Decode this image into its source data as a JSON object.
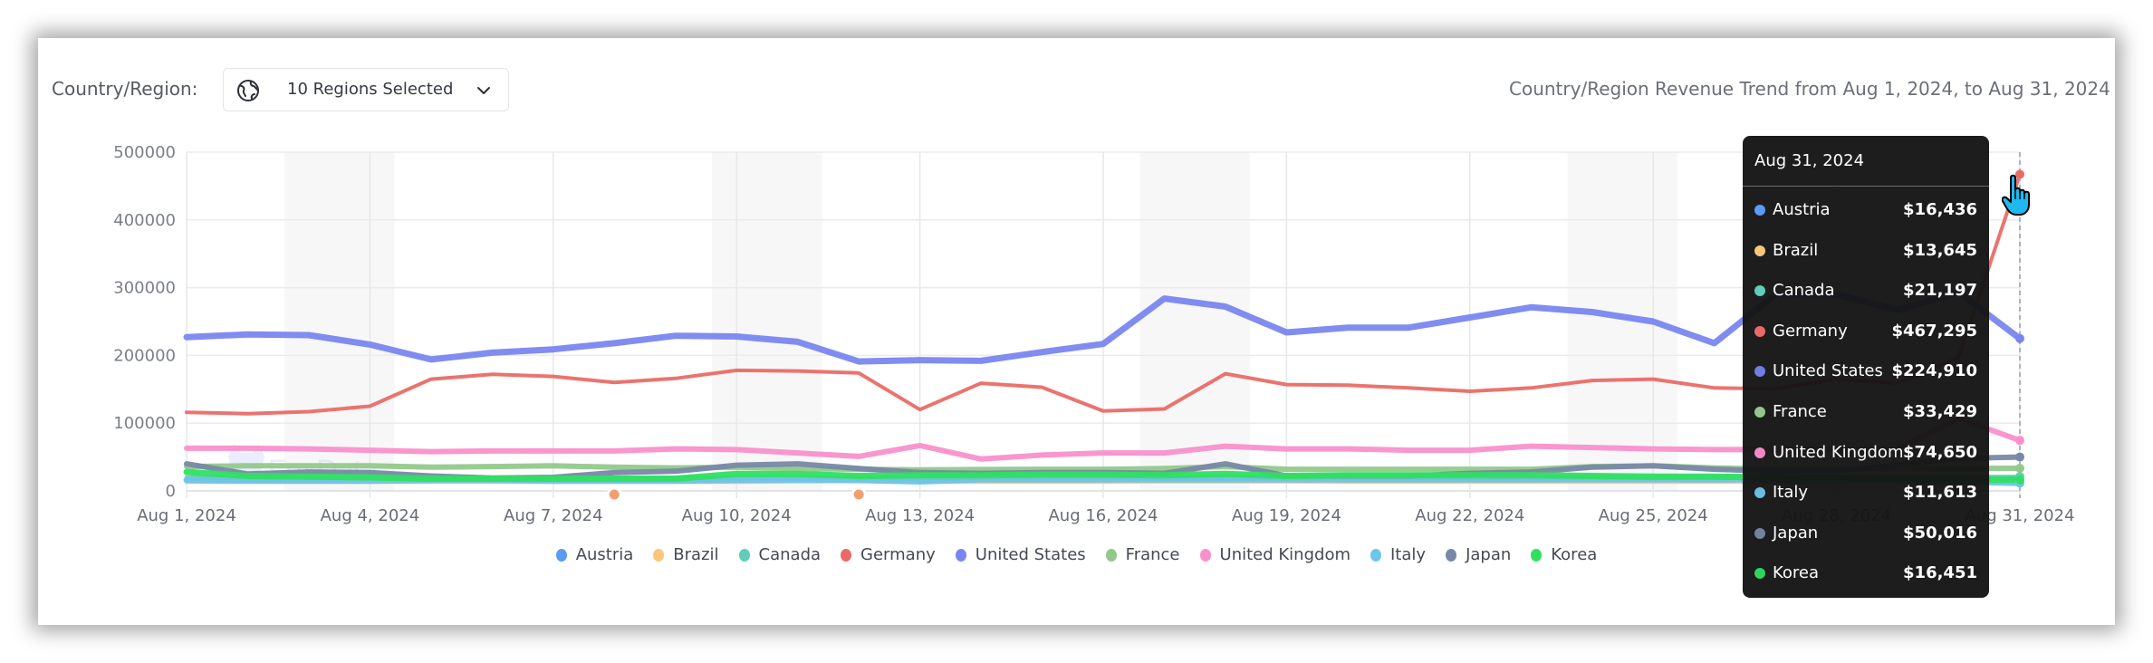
{
  "header": {
    "region_label": "Country/Region:",
    "region_select": {
      "value": "10 Regions Selected",
      "icon": "globe-icon",
      "dropdown_icon": "chevron-down-icon"
    },
    "trend_title": "Country/Region Revenue Trend from Aug 1, 2024, to Aug 31, 2024"
  },
  "watermark": "FoxData",
  "tooltip": {
    "date": "Aug 31, 2024",
    "rows": [
      {
        "name": "Austria",
        "value": "$16,436",
        "color": "#5b9cf2"
      },
      {
        "name": "Brazil",
        "value": "$13,645",
        "color": "#fbc67a"
      },
      {
        "name": "Canada",
        "value": "$21,197",
        "color": "#5fcdb8"
      },
      {
        "name": "Germany",
        "value": "$467,295",
        "color": "#ea6b66"
      },
      {
        "name": "United States",
        "value": "$224,910",
        "color": "#6e7fe2"
      },
      {
        "name": "France",
        "value": "$33,429",
        "color": "#92c98b"
      },
      {
        "name": "United Kingdom",
        "value": "$74,650",
        "color": "#f28ac4"
      },
      {
        "name": "Italy",
        "value": "$11,613",
        "color": "#6fbbe0"
      },
      {
        "name": "Japan",
        "value": "$50,016",
        "color": "#7482a0"
      },
      {
        "name": "Korea",
        "value": "$16,451",
        "color": "#2fd45e"
      }
    ]
  },
  "chart_data": {
    "type": "line",
    "title": "Country/Region Revenue Trend from Aug 1, 2024, to Aug 31, 2024",
    "xlabel": "",
    "ylabel": "",
    "ylim": [
      0,
      500000
    ],
    "yticks": [
      "0",
      "100000",
      "200000",
      "300000",
      "400000",
      "500000"
    ],
    "ytick_values": [
      0,
      100000,
      200000,
      300000,
      400000,
      500000
    ],
    "xtick_labels": [
      "Aug 1, 2024",
      "Aug 4, 2024",
      "Aug 7, 2024",
      "Aug 10, 2024",
      "Aug 13, 2024",
      "Aug 16, 2024",
      "Aug 19, 2024",
      "Aug 22, 2024",
      "Aug 25, 2024",
      "Aug 28, 2024",
      "Aug 31, 2024"
    ],
    "xtick_days": [
      1,
      4,
      7,
      10,
      13,
      16,
      19,
      22,
      25,
      28,
      31
    ],
    "x": [
      1,
      2,
      3,
      4,
      5,
      6,
      7,
      8,
      9,
      10,
      11,
      12,
      13,
      14,
      15,
      16,
      17,
      18,
      19,
      20,
      21,
      22,
      23,
      24,
      25,
      26,
      27,
      28,
      29,
      30,
      31
    ],
    "weekend_bands": [
      [
        3,
        4
      ],
      [
        10,
        11
      ],
      [
        17,
        18
      ],
      [
        24,
        25
      ]
    ],
    "event_markers": [
      {
        "day": 8.0,
        "color": "#f0a070"
      },
      {
        "day": 12.0,
        "color": "#f0a070"
      }
    ],
    "hover_day": 31,
    "grid": true,
    "legend_position": "bottom",
    "series": [
      {
        "name": "Austria",
        "color": "#5b9cf2",
        "width": 3,
        "values": [
          16000,
          15500,
          15000,
          15000,
          15500,
          16000,
          16000,
          16000,
          16500,
          17000,
          17000,
          16500,
          16000,
          16500,
          16500,
          17000,
          17000,
          16500,
          16500,
          16500,
          16500,
          16500,
          16500,
          16500,
          16500,
          16500,
          16500,
          16500,
          16500,
          16500,
          16436
        ]
      },
      {
        "name": "Brazil",
        "color": "#fbc67a",
        "width": 4,
        "values": [
          13000,
          13000,
          13000,
          13000,
          13000,
          13000,
          13000,
          13000,
          13000,
          13000,
          14000,
          14000,
          13500,
          13000,
          13000,
          13000,
          13500,
          13500,
          13500,
          13000,
          13000,
          13000,
          13000,
          13000,
          13000,
          13000,
          13000,
          13000,
          13500,
          13500,
          13645
        ]
      },
      {
        "name": "Canada",
        "color": "#5fcdb8",
        "width": 4,
        "values": [
          20000,
          19500,
          19000,
          19000,
          19000,
          19500,
          19500,
          19500,
          20000,
          20000,
          20500,
          20500,
          20000,
          20000,
          20500,
          20500,
          20500,
          21000,
          21000,
          21000,
          21000,
          21000,
          21000,
          21000,
          21000,
          21000,
          21000,
          21000,
          21000,
          21000,
          21197
        ]
      },
      {
        "name": "Germany",
        "color": "#ea6b66",
        "width": 4,
        "values": [
          116000,
          114000,
          117000,
          125000,
          165000,
          172000,
          169000,
          160000,
          166000,
          178000,
          177000,
          174000,
          120000,
          159000,
          153000,
          118000,
          121000,
          173000,
          157000,
          156000,
          152000,
          147000,
          152000,
          163000,
          165000,
          152000,
          151000,
          165000,
          159000,
          197000,
          467295
        ]
      },
      {
        "name": "United States",
        "color": "#7a86f0",
        "width": 7,
        "values": [
          227000,
          231000,
          230000,
          216000,
          194000,
          204000,
          209000,
          218000,
          229000,
          228000,
          220000,
          191000,
          193000,
          192000,
          205000,
          217000,
          284000,
          272000,
          234000,
          241000,
          241000,
          256000,
          271000,
          264000,
          250000,
          218000,
          290000,
          290000,
          267000,
          293000,
          224910
        ]
      },
      {
        "name": "France",
        "color": "#92c98b",
        "width": 6,
        "values": [
          36000,
          37000,
          37000,
          37000,
          35000,
          36000,
          37000,
          35000,
          34000,
          35000,
          33000,
          32000,
          31000,
          31500,
          32000,
          32000,
          33000,
          36000,
          32000,
          32000,
          32000,
          32000,
          32000,
          36000,
          37000,
          34000,
          32000,
          32000,
          33000,
          33000,
          33429
        ]
      },
      {
        "name": "United Kingdom",
        "color": "#f990cc",
        "width": 6,
        "values": [
          63000,
          63000,
          62000,
          60000,
          58000,
          59000,
          59000,
          59000,
          62000,
          61000,
          56000,
          51000,
          67000,
          47000,
          53000,
          56000,
          56000,
          66000,
          62000,
          62000,
          60000,
          60000,
          66000,
          64000,
          62000,
          61000,
          61000,
          62000,
          62000,
          107000,
          74650
        ]
      },
      {
        "name": "Italy",
        "color": "#6fc4ea",
        "width": 7,
        "values": [
          16000,
          15000,
          15000,
          15000,
          16000,
          16000,
          15000,
          15000,
          15000,
          16000,
          16000,
          16000,
          14000,
          17000,
          17000,
          17000,
          17000,
          17000,
          17000,
          17000,
          17000,
          17000,
          17000,
          17000,
          17000,
          17000,
          17000,
          16000,
          15000,
          14000,
          11613
        ]
      },
      {
        "name": "Japan",
        "color": "#7888a8",
        "width": 6,
        "values": [
          40000,
          25000,
          28000,
          27000,
          22000,
          19000,
          20000,
          27000,
          29000,
          38000,
          40000,
          33000,
          27000,
          26000,
          27000,
          27000,
          26000,
          40000,
          22000,
          22000,
          22000,
          26000,
          28000,
          35000,
          37000,
          32000,
          29000,
          30000,
          38000,
          48000,
          50016
        ]
      },
      {
        "name": "Korea",
        "color": "#2fe060",
        "width": 7,
        "values": [
          28000,
          22000,
          21000,
          20000,
          18000,
          18000,
          18000,
          18000,
          18000,
          25000,
          25000,
          22000,
          23000,
          23000,
          24000,
          24000,
          23000,
          25000,
          22000,
          23000,
          23000,
          23000,
          23000,
          22000,
          21000,
          21000,
          20000,
          19000,
          18000,
          17000,
          16451
        ]
      }
    ]
  }
}
